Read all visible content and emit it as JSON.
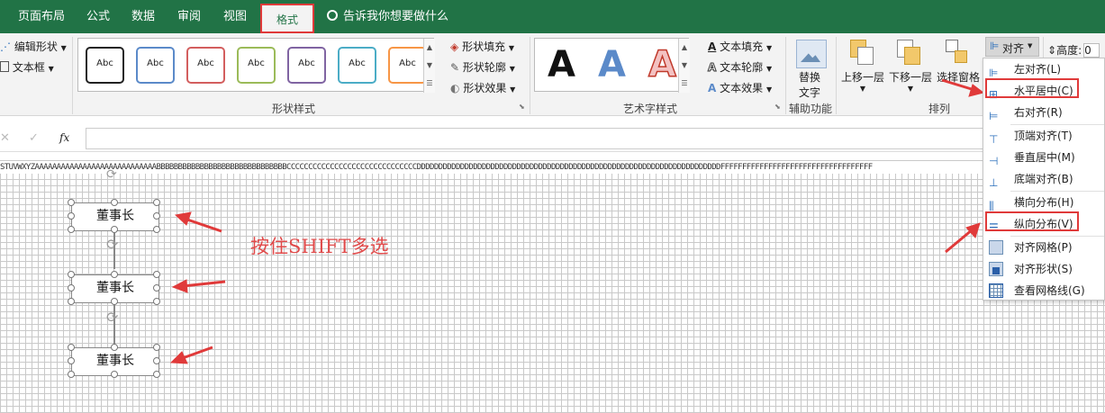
{
  "tabs": [
    {
      "label": "页面布局"
    },
    {
      "label": "公式"
    },
    {
      "label": "数据"
    },
    {
      "label": "审阅"
    },
    {
      "label": "视图"
    },
    {
      "label": "格式"
    }
  ],
  "tellme": "告诉我你想要做什么",
  "ribbon": {
    "insert": {
      "edit_shape": "编辑形状",
      "textbox": "文本框"
    },
    "shape_styles": {
      "group_label": "形状样式",
      "sample_text": "Abc",
      "border_colors": [
        "#222222",
        "#5b8ac9",
        "#d35e5e",
        "#9bbb59",
        "#8064a2",
        "#4bacc6",
        "#f79646"
      ],
      "fill": "形状填充",
      "outline": "形状轮廓",
      "effects": "形状效果"
    },
    "wordart": {
      "group_label": "艺术字样式",
      "letter": "A",
      "fill": "文本填充",
      "outline": "文本轮廓",
      "effects": "文本效果"
    },
    "accessibility": {
      "group_label": "辅助功能",
      "alt_text_line1": "替换",
      "alt_text_line2": "文字"
    },
    "arrange": {
      "group_label": "排列",
      "bring_forward": "上移一层",
      "send_backward": "下移一层",
      "selection_pane": "选择窗格",
      "align": "对齐"
    },
    "size": {
      "height_label": "高度:",
      "height_value": "0"
    }
  },
  "formula_bar": {
    "cancel": "✕",
    "enter": "✓",
    "fx": "fx"
  },
  "column_letters": "STUVWXYZAAAAAAAAAAAAAAAAAAAAAAAAAAAABBBBBBBBBBBBBBBBBBBBBBBBBBBBBBCCCCCCCCCCCCCCCCCCCCCCCCCCCCCCDDDDDDDDDDDDDDDDDDDDDDDDDDDDDDDDDDDDDDDDDDDDDDDDDDDDDDDDDDDDDDDDDDDDDDFFFFFFFFFFFFFFFFFFFFFFFFFFFFFFFFFFF",
  "shapes": [
    {
      "label": "董事长"
    },
    {
      "label": "董事长"
    },
    {
      "label": "董事长"
    }
  ],
  "hint": "按住SHIFT多选",
  "align_menu": {
    "items": [
      {
        "label": "左对齐(L)"
      },
      {
        "label": "水平居中(C)"
      },
      {
        "label": "右对齐(R)"
      },
      {
        "label": "顶端对齐(T)"
      },
      {
        "label": "垂直居中(M)"
      },
      {
        "label": "底端对齐(B)"
      },
      {
        "label": "横向分布(H)"
      },
      {
        "label": "纵向分布(V)"
      },
      {
        "label": "对齐网格(P)"
      },
      {
        "label": "对齐形状(S)"
      },
      {
        "label": "查看网格线(G)"
      }
    ]
  },
  "colors": {
    "excel_green": "#217346",
    "highlight_red": "#e03a3a",
    "annotation_red": "#e04a4a"
  }
}
